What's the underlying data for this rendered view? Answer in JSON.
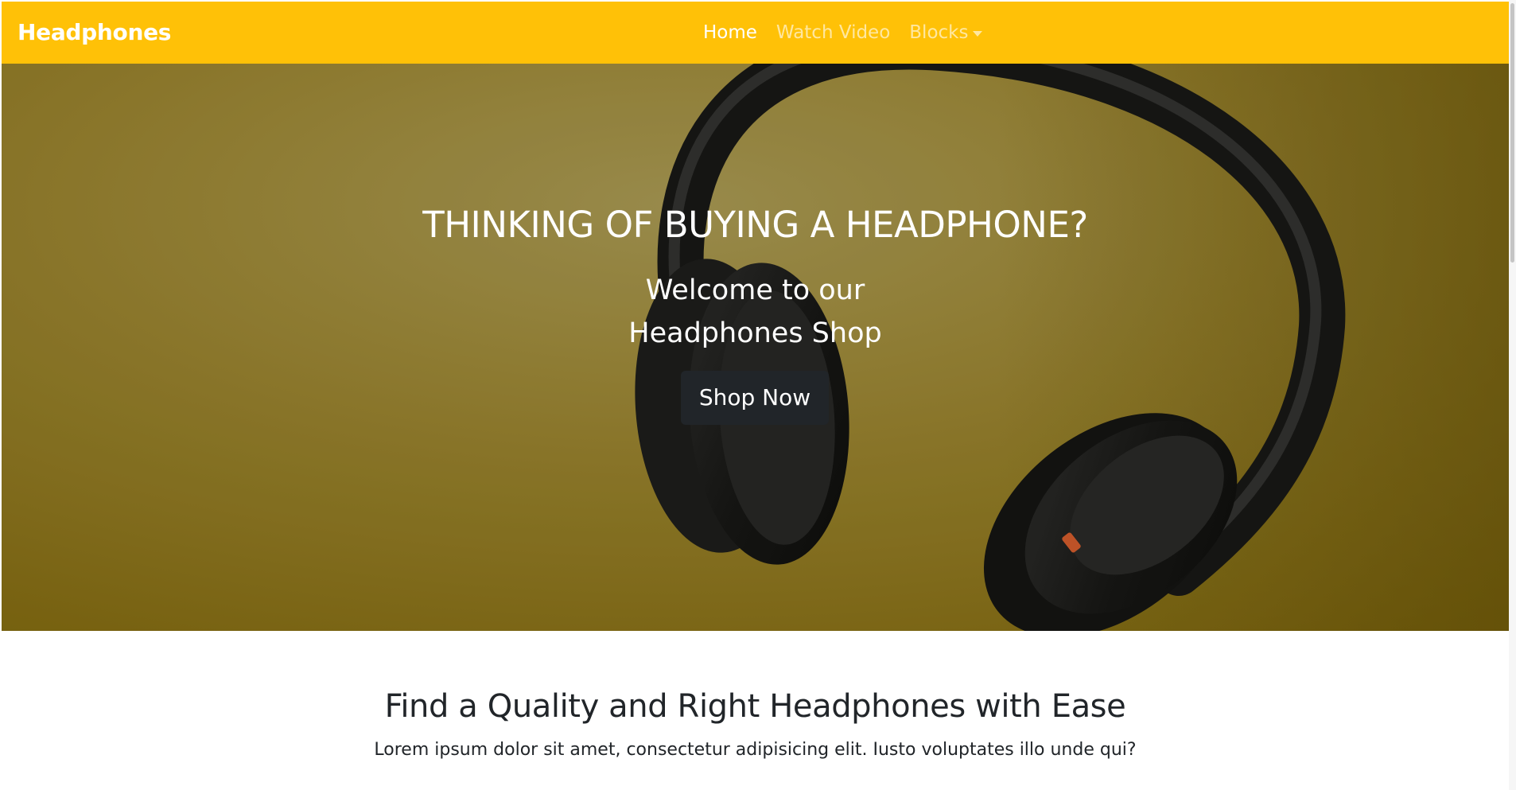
{
  "navbar": {
    "brand": "Headphones",
    "links": [
      {
        "label": "Home",
        "active": true
      },
      {
        "label": "Watch Video",
        "active": false
      },
      {
        "label": "Blocks",
        "active": false,
        "dropdown": true
      }
    ],
    "background_color": "#ffc107"
  },
  "hero": {
    "title": "THINKING OF BUYING A HEADPHONE?",
    "subtitle_line1": "Welcome to our",
    "subtitle_line2": "Headphones Shop",
    "button_label": "Shop Now",
    "image_subject": "black over-ear headphones on mustard yellow background"
  },
  "section": {
    "title": "Find a Quality and Right Headphones with Ease",
    "text": "Lorem ipsum dolor sit amet, consectetur adipisicing elit. Iusto voluptates illo unde qui?"
  },
  "colors": {
    "accent": "#ffc107",
    "dark_button": "#212529",
    "text": "#212529"
  }
}
